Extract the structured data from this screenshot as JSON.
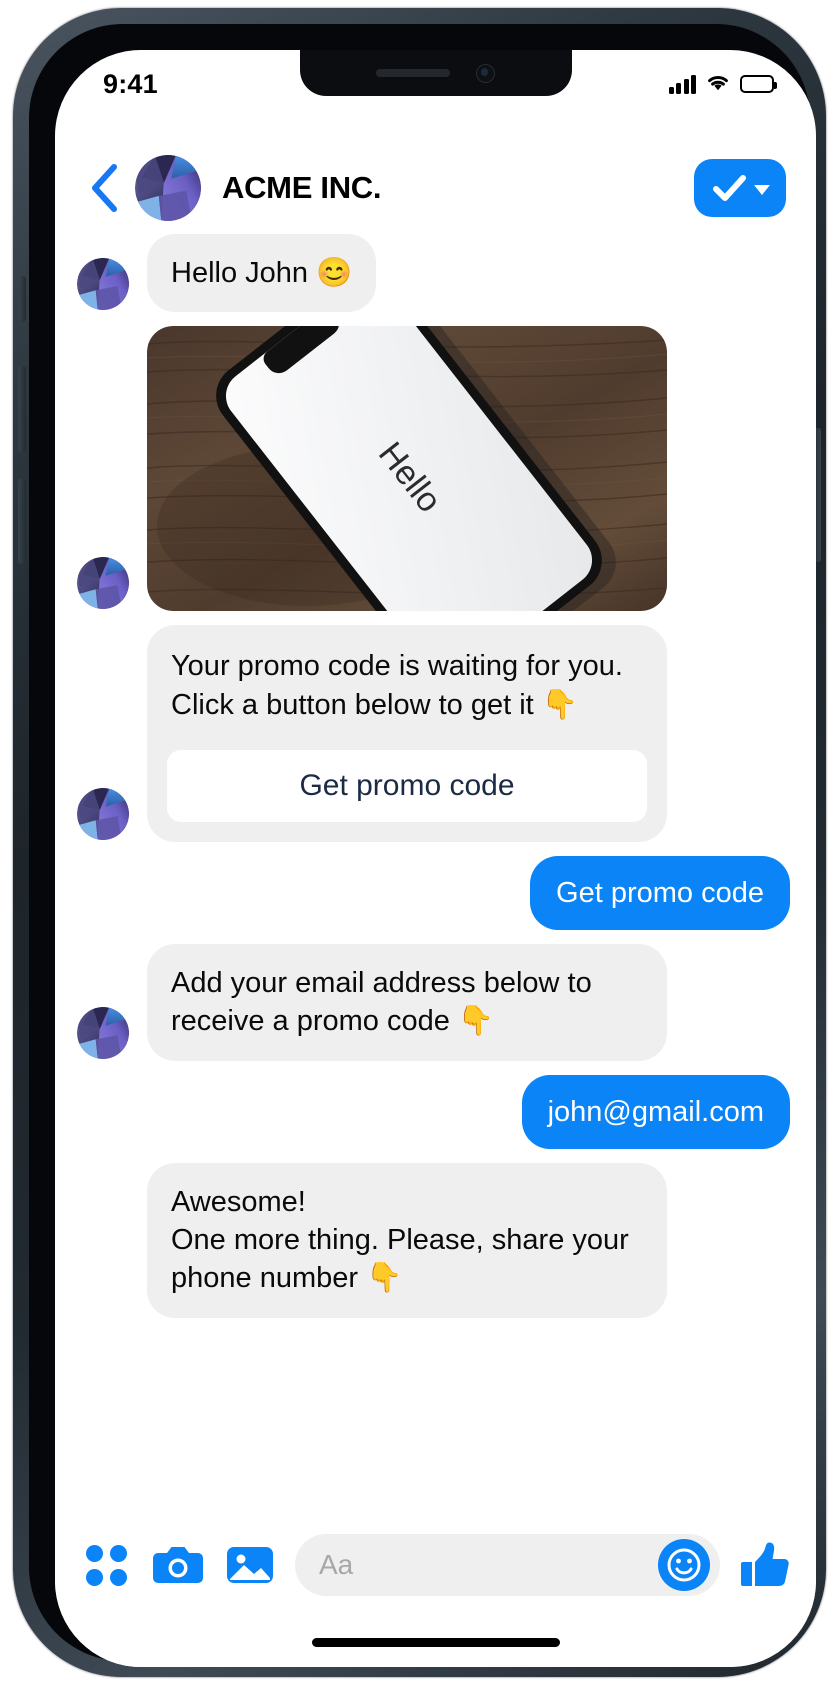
{
  "device": {
    "status_bar": {
      "time": "9:41",
      "cellular_icon": "signal-bars-icon",
      "wifi_icon": "wifi-icon",
      "battery_icon": "battery-full-icon"
    }
  },
  "header": {
    "back_icon": "back-chevron-icon",
    "avatar_icon": "acme-brand-avatar",
    "title": "ACME INC.",
    "subscribe_check_icon": "check-icon",
    "subscribe_caret_icon": "caret-down-icon"
  },
  "conversation": {
    "messages": [
      {
        "id": "msg-greeting",
        "direction": "in",
        "type": "text",
        "text": "Hello John 😊"
      },
      {
        "id": "msg-image",
        "direction": "in",
        "type": "image",
        "alt": "Smartphone on a dark wooden table showing the word Hello",
        "screen_text": "Hello"
      },
      {
        "id": "msg-promo-card",
        "direction": "in",
        "type": "card",
        "text": "Your promo code is waiting for you. Click a button below to get it 👇",
        "button_label": "Get promo code"
      },
      {
        "id": "msg-user-get-promo",
        "direction": "out",
        "type": "text",
        "text": "Get promo code"
      },
      {
        "id": "msg-ask-email",
        "direction": "in",
        "type": "text",
        "text": "Add your email address below to receive a promo code 👇"
      },
      {
        "id": "msg-user-email",
        "direction": "out",
        "type": "text",
        "text": "john@gmail.com"
      },
      {
        "id": "msg-ask-phone",
        "direction": "in",
        "type": "text",
        "text": "Awesome!\nOne more thing. Please, share your phone number 👇"
      }
    ]
  },
  "composer": {
    "apps_icon": "apps-grid-icon",
    "camera_icon": "camera-icon",
    "gallery_icon": "image-icon",
    "input_placeholder": "Aa",
    "input_value": "",
    "emoji_icon": "smiley-face-icon",
    "like_icon": "thumbs-up-icon"
  },
  "colors": {
    "accent_blue": "#0a84f7",
    "incoming_bubble": "#efefef",
    "card_button_text": "#1c2b45",
    "text_primary": "#0a0a0a"
  }
}
